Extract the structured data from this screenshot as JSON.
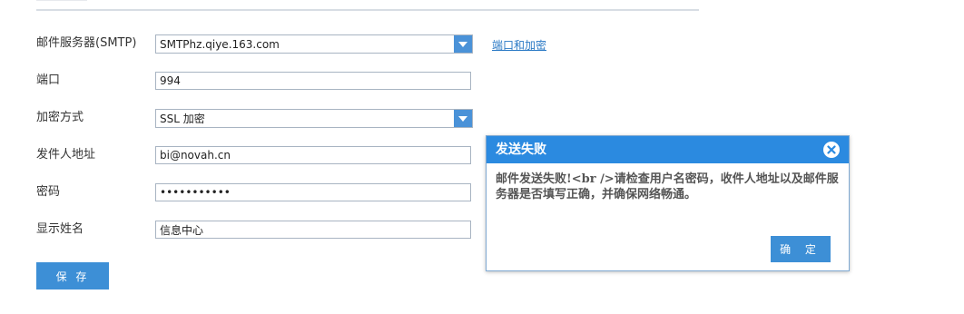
{
  "form": {
    "smtp_label": "邮件服务器(SMTP)",
    "smtp_value": "SMTPhz.qiye.163.com",
    "port_link": "端口和加密",
    "port_label": "端口",
    "port_value": "994",
    "encryption_label": "加密方式",
    "encryption_value": "SSL 加密",
    "sender_label": "发件人地址",
    "sender_value": "bi@novah.cn",
    "password_label": "密码",
    "password_value": "•••••••••••",
    "display_name_label": "显示姓名",
    "display_name_value": "信息中心",
    "save_label": "保 存"
  },
  "dialog": {
    "title": "发送失败",
    "message": "邮件发送失败!<br  />请检查用户名密码，收件人地址以及邮件服务器是否填写正确，并确保网络畅通。",
    "ok_label": "确 定"
  },
  "colors": {
    "accent": "#3d8fd6",
    "dialog_header": "#2b8ae0",
    "link": "#2a79c5"
  }
}
